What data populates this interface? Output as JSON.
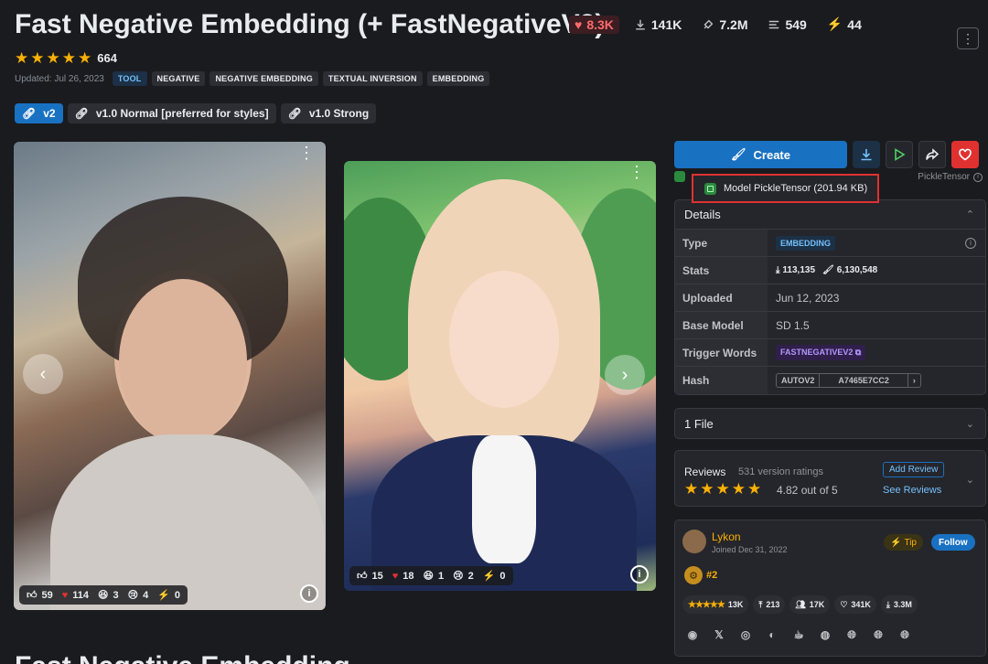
{
  "header": {
    "title": "Fast Negative Embedding (+ FastNegativeV2)",
    "stats": {
      "likes": "8.3K",
      "downloads": "141K",
      "generations": "7.2M",
      "comments": "549",
      "tips": "44"
    },
    "rating": {
      "stars": 5,
      "count": "664"
    },
    "updated": "Updated: Jul 26, 2023",
    "tags": [
      "TOOL",
      "NEGATIVE",
      "NEGATIVE EMBEDDING",
      "TEXTUAL INVERSION",
      "EMBEDDING"
    ]
  },
  "versions": [
    {
      "label": "v2",
      "active": true
    },
    {
      "label": "v1.0 Normal [preferred for styles]",
      "active": false
    },
    {
      "label": "v1.0 Strong",
      "active": false
    }
  ],
  "gallery": [
    {
      "reactions": {
        "like": "59",
        "heart": "114",
        "laugh": "3",
        "cry": "4",
        "tip": "0"
      }
    },
    {
      "reactions": {
        "like": "15",
        "heart": "18",
        "laugh": "1",
        "cry": "2",
        "tip": "0"
      }
    }
  ],
  "actions": {
    "create_label": "Create"
  },
  "scan": {
    "tooltip": "Model PickleTensor (201.94 KB)",
    "right_label": "PickleTensor"
  },
  "details": {
    "heading": "Details",
    "rows": {
      "type": {
        "label": "Type",
        "value": "EMBEDDING"
      },
      "stats": {
        "label": "Stats",
        "downloads": "113,135",
        "generations": "6,130,548"
      },
      "uploaded": {
        "label": "Uploaded",
        "value": "Jun 12, 2023"
      },
      "base_model": {
        "label": "Base Model",
        "value": "SD 1.5"
      },
      "trigger": {
        "label": "Trigger Words",
        "value": "FASTNEGATIVEV2"
      },
      "hash": {
        "label": "Hash",
        "key": "AUTOV2",
        "value": "A7465E7CC2"
      }
    }
  },
  "files": {
    "label": "1 File"
  },
  "reviews": {
    "title": "Reviews",
    "count": "531 version ratings",
    "score": "4.82 out of 5",
    "add_label": "Add Review",
    "see_label": "See Reviews"
  },
  "creator": {
    "name": "Lykon",
    "joined": "Joined Dec 31, 2022",
    "tip_label": "Tip",
    "follow_label": "Follow",
    "rank": "#2",
    "stats": {
      "ratings": "13K",
      "uploads": "213",
      "followers": "17K",
      "likes": "341K",
      "downloads": "3.3M"
    }
  },
  "footer": {
    "title": "Fast Negative Embedding"
  },
  "colors": {
    "accent": "#1971c2",
    "favorite": "#e03131",
    "star": "#fab005"
  }
}
